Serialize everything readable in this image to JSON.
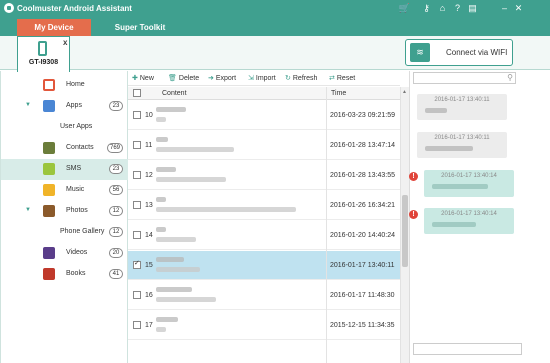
{
  "app": {
    "title": "Coolmuster Android Assistant"
  },
  "tabs": {
    "my_device": "My Device",
    "super_toolkit": "Super Toolkit"
  },
  "device": {
    "name": "GT-I9308",
    "disconnect_icon": "x"
  },
  "wifi": {
    "label": "Connect via WIFI"
  },
  "sidebar": {
    "items": [
      {
        "label": "Home",
        "icon": "home-icon"
      },
      {
        "label": "Apps",
        "count": "23",
        "expanded": true,
        "icon": "apps-icon"
      },
      {
        "label": "User Apps"
      },
      {
        "label": "Contacts",
        "count": "769",
        "icon": "contacts-icon"
      },
      {
        "label": "SMS",
        "count": "23",
        "selected": true,
        "icon": "sms-icon"
      },
      {
        "label": "Music",
        "count": "56",
        "icon": "music-icon"
      },
      {
        "label": "Photos",
        "count": "12",
        "expanded": true,
        "icon": "photos-icon"
      },
      {
        "label": "Phone Gallery",
        "count": "12"
      },
      {
        "label": "Videos",
        "count": "20",
        "icon": "videos-icon"
      },
      {
        "label": "Books",
        "count": "41",
        "icon": "books-icon"
      }
    ]
  },
  "toolbar": {
    "new": "New",
    "delete": "Delete",
    "export": "Export",
    "import": "Import",
    "refresh": "Refresh",
    "reset": "Reset"
  },
  "table": {
    "headers": {
      "content": "Content",
      "time": "Time"
    },
    "rows": [
      {
        "num": "10",
        "time": "2016-03-23 09:21:59"
      },
      {
        "num": "11",
        "time": "2016-01-28 13:47:14"
      },
      {
        "num": "12",
        "time": "2016-01-28 13:43:55"
      },
      {
        "num": "13",
        "time": "2016-01-26 16:34:21"
      },
      {
        "num": "14",
        "time": "2016-01-20 14:40:24"
      },
      {
        "num": "15",
        "time": "2016-01-17 13:40:11",
        "selected": true
      },
      {
        "num": "16",
        "time": "2016-01-17 11:48:30"
      },
      {
        "num": "17",
        "time": "2015-12-15 11:34:35"
      }
    ]
  },
  "chat": {
    "messages": [
      {
        "time": "2016-01-17 13:40:11",
        "direction": "in"
      },
      {
        "time": "2016-01-17 13:40:11",
        "direction": "in"
      },
      {
        "time": "2016-01-17 13:40:14",
        "direction": "out",
        "failed": true
      },
      {
        "time": "2016-01-17 13:40:14",
        "direction": "out",
        "failed": true
      }
    ],
    "fail_icon": "!"
  },
  "colors": {
    "accent": "#3fa08f",
    "active_tab": "#e46d4c",
    "selected_row": "#bfe2f0",
    "fail": "#e0443a"
  }
}
